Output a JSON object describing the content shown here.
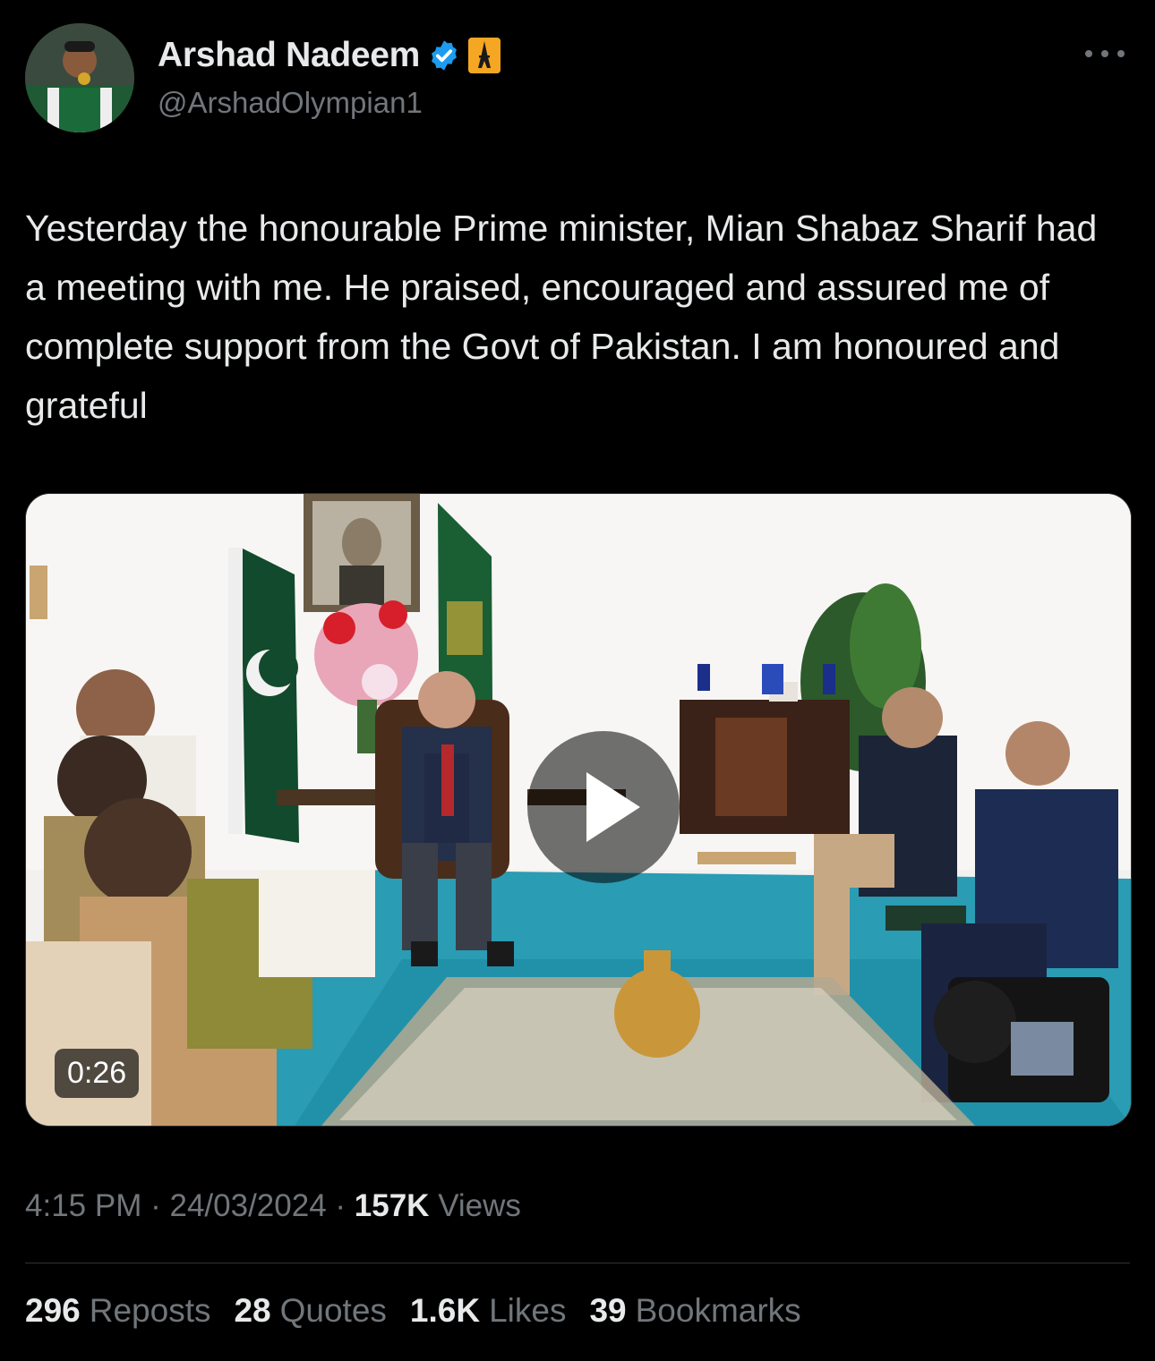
{
  "author": {
    "name": "Arshad Nadeem",
    "handle": "@ArshadOlympian1",
    "badge_icons": [
      "verified-badge-icon",
      "eiffel-tower-emoji"
    ]
  },
  "tweet": {
    "text": "Yesterday the honourable Prime minister, Mian Shabaz Sharif had a meeting with me. He praised, encouraged and assured me of complete support from the Govt of Pakistan. I am honoured and grateful"
  },
  "media": {
    "type": "video",
    "duration": "0:26"
  },
  "meta": {
    "time": "4:15 PM",
    "date": "24/03/2024",
    "views_count": "157K",
    "views_label": "Views",
    "separator": "·"
  },
  "stats": [
    {
      "count": "296",
      "label": "Reposts"
    },
    {
      "count": "28",
      "label": "Quotes"
    },
    {
      "count": "1.6K",
      "label": "Likes"
    },
    {
      "count": "39",
      "label": "Bookmarks"
    }
  ],
  "colors": {
    "background": "#000000",
    "text": "#e7e9ea",
    "muted": "#71767b",
    "verified": "#1d9bf0",
    "divider": "#2f3336"
  }
}
